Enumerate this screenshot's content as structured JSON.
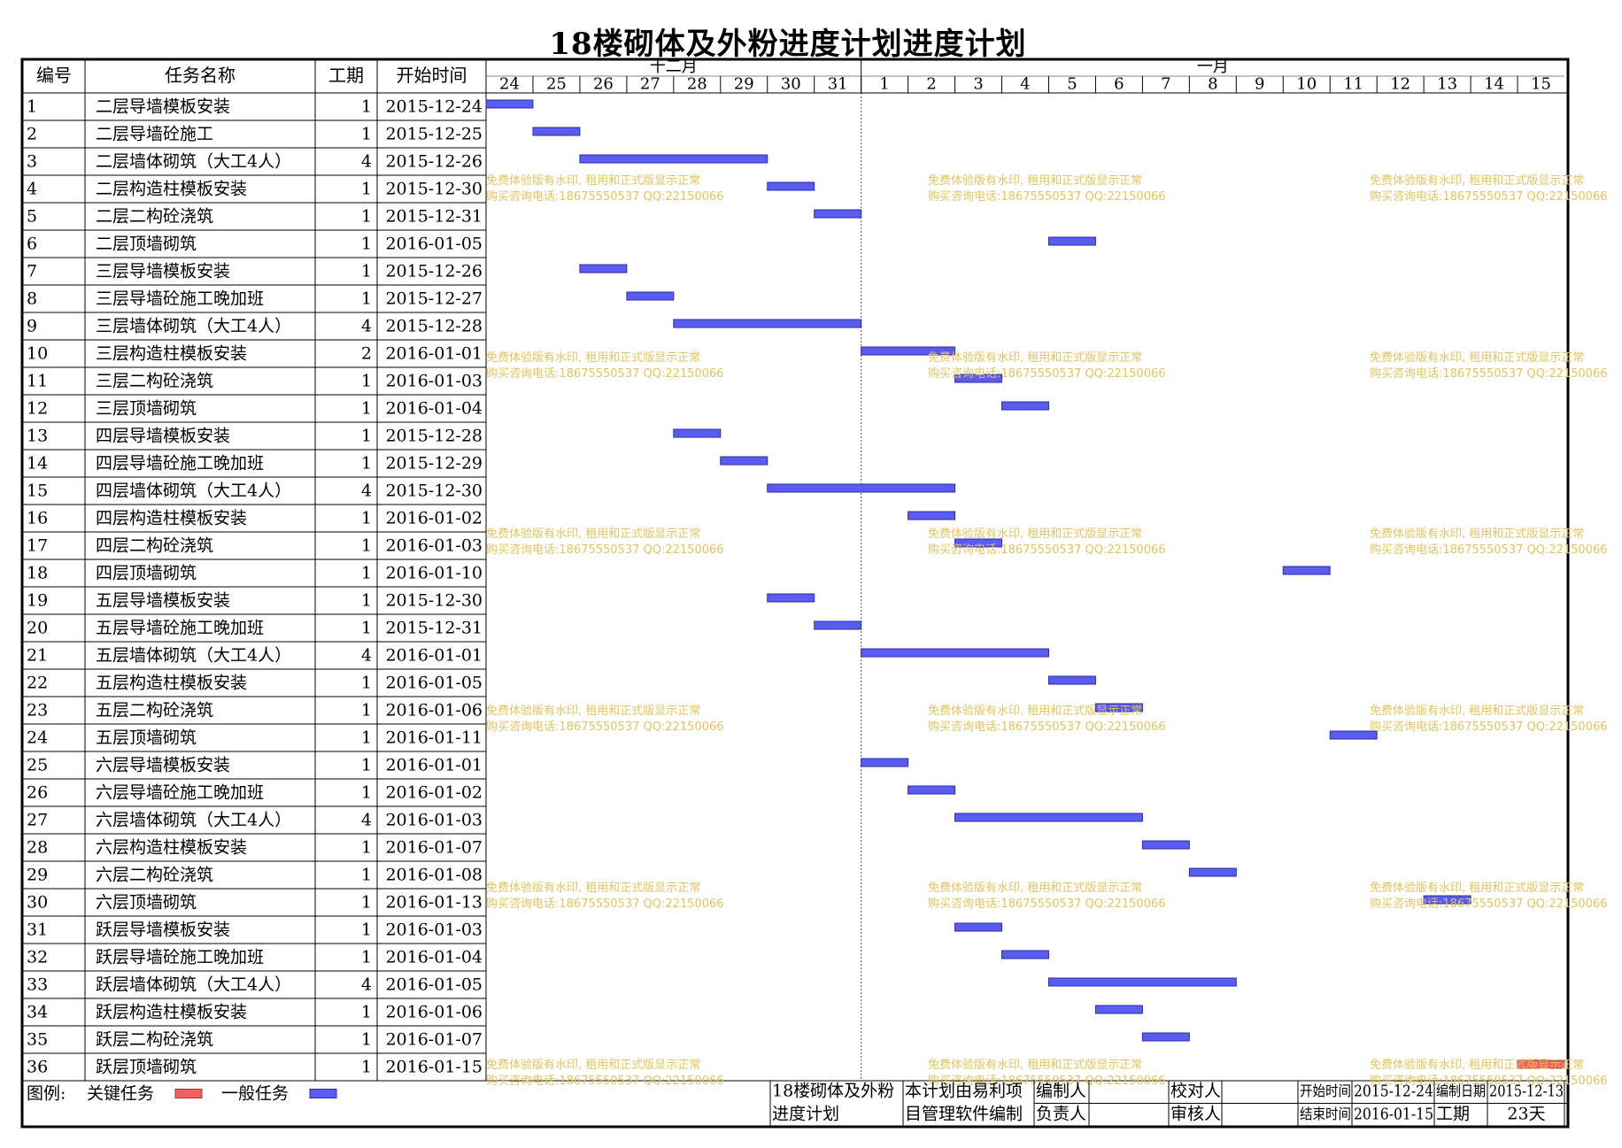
{
  "title": "18楼砌体及外粉进度计划进度计划",
  "columns": {
    "id": "编号",
    "name": "任务名称",
    "duration": "工期",
    "start": "开始时间"
  },
  "months": [
    {
      "label": "十二月",
      "first_day": "2015-12-24",
      "last_day": "2015-12-31"
    },
    {
      "label": "一月",
      "first_day": "2016-01-01",
      "last_day": "2016-01-15"
    }
  ],
  "days": [
    "24",
    "25",
    "26",
    "27",
    "28",
    "29",
    "30",
    "31",
    "1",
    "2",
    "3",
    "4",
    "5",
    "6",
    "7",
    "8",
    "9",
    "10",
    "11",
    "12",
    "13",
    "14",
    "15"
  ],
  "watermark": [
    "免费体验版有水印, 租用和正式版显示正常",
    "购买咨询电话:18675550537 QQ:22150066"
  ],
  "legend": {
    "label": "图例:",
    "critical": "关键任务",
    "normal": "一般任务"
  },
  "footer": {
    "plan_name": [
      "18楼砌体及外粉",
      "进度计划"
    ],
    "software": [
      "本计划由易利项",
      "目管理软件编制"
    ],
    "author_label": "编制人",
    "checker_label": "校对人",
    "owner_label": "负责人",
    "reviewer_label": "审核人",
    "start_label": "开始时间",
    "start_value": "2015-12-24",
    "end_label": "结束时间",
    "end_value": "2016-01-15",
    "made_label": "编制日期",
    "made_value": "2015-12-13",
    "duration_label": "工期",
    "duration_value": "23天"
  },
  "colors": {
    "normal": "#5a5cf0",
    "normal_border": "#2b2bb0",
    "critical": "#f06262",
    "watermark": "#e2c35c"
  },
  "chart_data": {
    "type": "gantt",
    "x_start": "2015-12-24",
    "x_end": "2016-01-15",
    "tasks": [
      {
        "id": "1",
        "name": "二层导墙模板安装",
        "duration": 1,
        "start": "2015-12-24",
        "critical": false
      },
      {
        "id": "2",
        "name": "二层导墙砼施工",
        "duration": 1,
        "start": "2015-12-25",
        "critical": false
      },
      {
        "id": "3",
        "name": "二层墙体砌筑（大工4人）",
        "duration": 4,
        "start": "2015-12-26",
        "critical": false
      },
      {
        "id": "4",
        "name": "二层构造柱模板安装",
        "duration": 1,
        "start": "2015-12-30",
        "critical": false
      },
      {
        "id": "5",
        "name": "二层二构砼浇筑",
        "duration": 1,
        "start": "2015-12-31",
        "critical": false
      },
      {
        "id": "6",
        "name": "二层顶墙砌筑",
        "duration": 1,
        "start": "2016-01-05",
        "critical": false
      },
      {
        "id": "7",
        "name": "三层导墙模板安装",
        "duration": 1,
        "start": "2015-12-26",
        "critical": false
      },
      {
        "id": "8",
        "name": "三层导墙砼施工晚加班",
        "duration": 1,
        "start": "2015-12-27",
        "critical": false
      },
      {
        "id": "9",
        "name": "三层墙体砌筑（大工4人）",
        "duration": 4,
        "start": "2015-12-28",
        "critical": false
      },
      {
        "id": "10",
        "name": "三层构造柱模板安装",
        "duration": 2,
        "start": "2016-01-01",
        "critical": false
      },
      {
        "id": "11",
        "name": "三层二构砼浇筑",
        "duration": 1,
        "start": "2016-01-03",
        "critical": false
      },
      {
        "id": "12",
        "name": "三层顶墙砌筑",
        "duration": 1,
        "start": "2016-01-04",
        "critical": false
      },
      {
        "id": "13",
        "name": "四层导墙模板安装",
        "duration": 1,
        "start": "2015-12-28",
        "critical": false
      },
      {
        "id": "14",
        "name": "四层导墙砼施工晚加班",
        "duration": 1,
        "start": "2015-12-29",
        "critical": false
      },
      {
        "id": "15",
        "name": "四层墙体砌筑（大工4人）",
        "duration": 4,
        "start": "2015-12-30",
        "critical": false
      },
      {
        "id": "16",
        "name": "四层构造柱模板安装",
        "duration": 1,
        "start": "2016-01-02",
        "critical": false
      },
      {
        "id": "17",
        "name": "四层二构砼浇筑",
        "duration": 1,
        "start": "2016-01-03",
        "critical": false
      },
      {
        "id": "18",
        "name": "四层顶墙砌筑",
        "duration": 1,
        "start": "2016-01-10",
        "critical": false
      },
      {
        "id": "19",
        "name": "五层导墙模板安装",
        "duration": 1,
        "start": "2015-12-30",
        "critical": false
      },
      {
        "id": "20",
        "name": "五层导墙砼施工晚加班",
        "duration": 1,
        "start": "2015-12-31",
        "critical": false
      },
      {
        "id": "21",
        "name": "五层墙体砌筑（大工4人）",
        "duration": 4,
        "start": "2016-01-01",
        "critical": false
      },
      {
        "id": "22",
        "name": "五层构造柱模板安装",
        "duration": 1,
        "start": "2016-01-05",
        "critical": false
      },
      {
        "id": "23",
        "name": "五层二构砼浇筑",
        "duration": 1,
        "start": "2016-01-06",
        "critical": false
      },
      {
        "id": "24",
        "name": "五层顶墙砌筑",
        "duration": 1,
        "start": "2016-01-11",
        "critical": false
      },
      {
        "id": "25",
        "name": "六层导墙模板安装",
        "duration": 1,
        "start": "2016-01-01",
        "critical": false
      },
      {
        "id": "26",
        "name": "六层导墙砼施工晚加班",
        "duration": 1,
        "start": "2016-01-02",
        "critical": false
      },
      {
        "id": "27",
        "name": "六层墙体砌筑（大工4人）",
        "duration": 4,
        "start": "2016-01-03",
        "critical": false
      },
      {
        "id": "28",
        "name": "六层构造柱模板安装",
        "duration": 1,
        "start": "2016-01-07",
        "critical": false
      },
      {
        "id": "29",
        "name": "六层二构砼浇筑",
        "duration": 1,
        "start": "2016-01-08",
        "critical": false
      },
      {
        "id": "30",
        "name": "六层顶墙砌筑",
        "duration": 1,
        "start": "2016-01-13",
        "critical": false
      },
      {
        "id": "31",
        "name": "跃层导墙模板安装",
        "duration": 1,
        "start": "2016-01-03",
        "critical": false
      },
      {
        "id": "32",
        "name": "跃层导墙砼施工晚加班",
        "duration": 1,
        "start": "2016-01-04",
        "critical": false
      },
      {
        "id": "33",
        "name": "跃层墙体砌筑（大工4人）",
        "duration": 4,
        "start": "2016-01-05",
        "critical": false
      },
      {
        "id": "34",
        "name": "跃层构造柱模板安装",
        "duration": 1,
        "start": "2016-01-06",
        "critical": false
      },
      {
        "id": "35",
        "name": "跃层二构砼浇筑",
        "duration": 1,
        "start": "2016-01-07",
        "critical": false
      },
      {
        "id": "36",
        "name": "跃层顶墙砌筑",
        "duration": 1,
        "start": "2016-01-15",
        "critical": true
      }
    ]
  }
}
